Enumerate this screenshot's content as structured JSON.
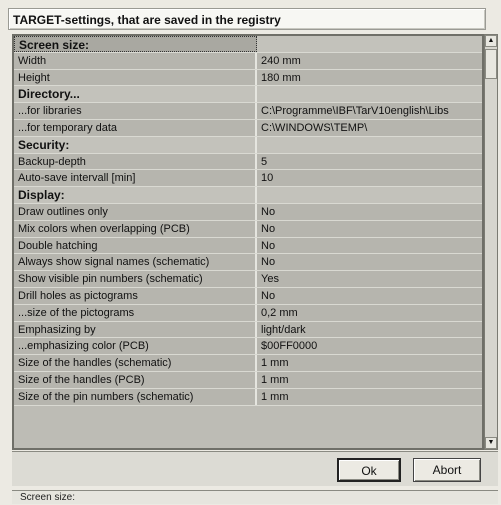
{
  "window": {
    "title": "TARGET-settings, that are saved in the registry"
  },
  "rows": [
    {
      "name": "Screen size:",
      "value": "",
      "header": true
    },
    {
      "name": "Width",
      "value": "240 mm"
    },
    {
      "name": "Height",
      "value": "180 mm"
    },
    {
      "name": "Directory...",
      "value": "",
      "header": true
    },
    {
      "name": "...for libraries",
      "value": "C:\\Programme\\IBF\\TarV10english\\Libs"
    },
    {
      "name": "...for temporary data",
      "value": "C:\\WINDOWS\\TEMP\\"
    },
    {
      "name": "Security:",
      "value": "",
      "header": true
    },
    {
      "name": "Backup-depth",
      "value": "5"
    },
    {
      "name": "Auto-save intervall [min]",
      "value": "10"
    },
    {
      "name": "Display:",
      "value": "",
      "header": true
    },
    {
      "name": "Draw outlines only",
      "value": "No"
    },
    {
      "name": "Mix colors when overlapping (PCB)",
      "value": "No"
    },
    {
      "name": "Double hatching",
      "value": "No"
    },
    {
      "name": "Always show signal names (schematic)",
      "value": "No"
    },
    {
      "name": "Show visible pin numbers (schematic)",
      "value": "Yes"
    },
    {
      "name": "Drill holes as pictograms",
      "value": "No"
    },
    {
      "name": "...size of the pictograms",
      "value": "0,2 mm"
    },
    {
      "name": "Emphasizing by",
      "value": "light/dark"
    },
    {
      "name": "...emphasizing color (PCB)",
      "value": "$00FF0000"
    },
    {
      "name": "Size of the handles (schematic)",
      "value": "1 mm"
    },
    {
      "name": "Size of the handles (PCB)",
      "value": "1 mm"
    },
    {
      "name": "Size of the pin numbers (schematic)",
      "value": "1 mm"
    }
  ],
  "buttons": {
    "ok_label": "Ok",
    "abort_label": "Abort"
  },
  "status": {
    "text": "Screen size:"
  }
}
